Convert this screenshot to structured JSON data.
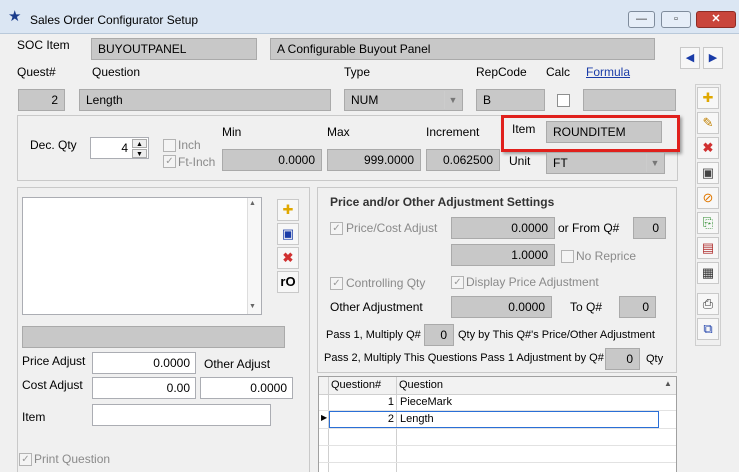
{
  "window": {
    "title": "Sales Order Configurator Setup",
    "icon": "star-icon",
    "minimize_glyph": "—",
    "restore_glyph": "▫",
    "close_glyph": "✕"
  },
  "header": {
    "soc_item_label": "SOC Item",
    "soc_item_value": "BUYOUTPANEL",
    "soc_desc_value": "A Configurable Buyout Panel",
    "prev_glyph": "◀",
    "next_glyph": "▶"
  },
  "question_row": {
    "quest_label": "Quest#",
    "question_label": "Question",
    "type_label": "Type",
    "repcode_label": "RepCode",
    "calc_label": "Calc",
    "formula_link": "Formula",
    "quest_value": "2",
    "question_value": "Length",
    "type_value": "NUM",
    "repcode_value": "B",
    "formula_value": ""
  },
  "numeric": {
    "dec_qty_label": "Dec. Qty",
    "dec_qty_value": "4",
    "inch_label": "Inch",
    "ftinch_label": "Ft-Inch",
    "min_label": "Min",
    "max_label": "Max",
    "increment_label": "Increment",
    "min_value": "0.0000",
    "max_value": "999.0000",
    "increment_value": "0.062500",
    "item_label": "Item",
    "item_value": "ROUNDITEM",
    "unit_label": "Unit",
    "unit_value": "FT",
    "highlight_color": "#e0201c"
  },
  "left_panel": {
    "price_adjust_label": "Price Adjust",
    "price_adjust_value": "0.0000",
    "other_adjust_label": "Other Adjust",
    "cost_adjust_label": "Cost Adjust",
    "cost_adjust_value": "0.00",
    "other_adjust_value": "0.0000",
    "item_label": "Item",
    "item_value": "",
    "print_question_label": "Print Question",
    "ro_button": "rO"
  },
  "adjust": {
    "heading": "Price and/or Other Adjustment Settings",
    "price_cost_adjust_label": "Price/Cost Adjust",
    "price_cost_value": "0.0000",
    "or_from_label": "or From Q#",
    "or_from_value": "0",
    "multiplier_value": "1.0000",
    "no_reprice_label": "No Reprice",
    "controlling_qty_label": "Controlling Qty",
    "display_price_adj_label": "Display Price Adjustment",
    "other_adjustment_label": "Other Adjustment",
    "other_adjustment_value": "0.0000",
    "to_q_label": "To Q#",
    "to_q_value": "0",
    "pass1_prefix": "Pass 1, Multiply Q#",
    "pass1_value": "0",
    "pass1_suffix": "Qty by This Q#'s Price/Other Adjustment",
    "pass2_prefix": "Pass 2, Multiply This Questions Pass 1 Adjustment by Q#",
    "pass2_value": "0",
    "pass2_suffix": "Qty"
  },
  "grid": {
    "columns": [
      "Question#",
      "Question"
    ],
    "rows": [
      {
        "num": "1",
        "question": "PieceMark"
      },
      {
        "num": "2",
        "question": "Length"
      }
    ]
  },
  "toolbar": {
    "icons": [
      "new-icon",
      "edit-icon",
      "delete-icon",
      "save-icon",
      "cancel-icon",
      "copy-icon",
      "report-icon",
      "card-icon",
      "print-icon",
      "paste-icon"
    ]
  }
}
